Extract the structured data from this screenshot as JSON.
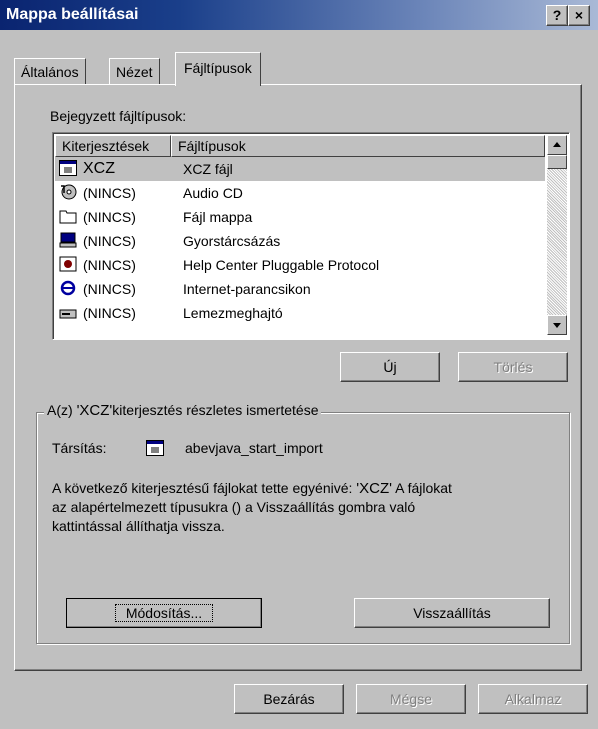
{
  "window": {
    "title": "Mappa beállításai",
    "help_btn": "?",
    "close_btn": "×"
  },
  "tabs": [
    {
      "label": "Általános"
    },
    {
      "label": "Nézet"
    },
    {
      "label": "Fájltípusok"
    }
  ],
  "registered_label": "Bejegyzett fájltípusok:",
  "list": {
    "headers": [
      "Kiterjesztések",
      "Fájltípusok"
    ],
    "rows": [
      {
        "ext": "XCZ",
        "type": "XCZ fájl",
        "icon": "app-icon",
        "selected": true
      },
      {
        "ext": "(NINCS)",
        "type": "Audio CD",
        "icon": "cd-icon"
      },
      {
        "ext": "(NINCS)",
        "type": "Fájl mappa",
        "icon": "folder-icon"
      },
      {
        "ext": "(NINCS)",
        "type": "Gyorstárcsázás",
        "icon": "phone-icon"
      },
      {
        "ext": "(NINCS)",
        "type": "Help Center Pluggable Protocol",
        "icon": "help-icon"
      },
      {
        "ext": "(NINCS)",
        "type": "Internet-parancsikon",
        "icon": "ie-icon"
      },
      {
        "ext": "(NINCS)",
        "type": "Lemezmeghajtó",
        "icon": "drive-icon"
      }
    ]
  },
  "buttons": {
    "new": "Új",
    "delete": "Törlés",
    "modify": "Módosítás...",
    "restore": "Visszaállítás",
    "close": "Bezárás",
    "cancel": "Mégse",
    "apply": "Alkalmaz"
  },
  "details": {
    "caption_pre": "A(z) ",
    "caption_ext": "'XCZ'",
    "caption_post": "kiterjesztés részletes ismertetése",
    "assoc_label": "Társítás:",
    "assoc_value": "abevjava_start_import",
    "desc_line1_pre": "A következő kiterjesztésű fájlokat tette egyénivé: ",
    "desc_line1_ext": "'XCZ'",
    "desc_line1_post": " A fájlokat",
    "desc_line2": "az alapértelmezett típusukra () a Visszaállítás gombra való",
    "desc_line3": "kattintással állíthatja vissza."
  }
}
